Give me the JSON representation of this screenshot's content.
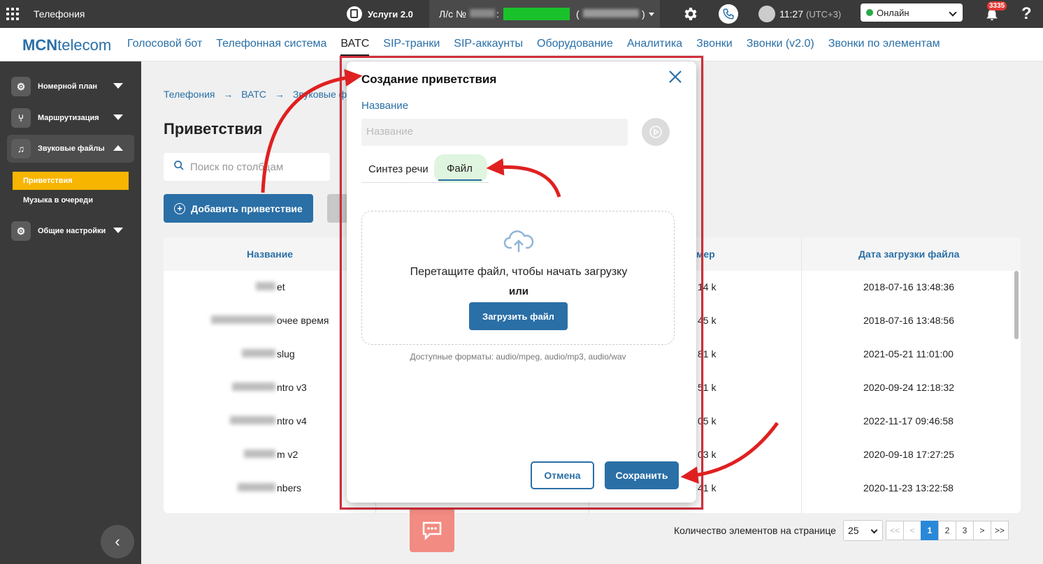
{
  "topbar": {
    "app_title": "Телефония",
    "services": "Услуги 2.0",
    "account_label": "Л/с №",
    "account_colon": ":",
    "account_paren_open": "(",
    "account_paren_close": ")",
    "time": "11:27",
    "timezone": "(UTC+3)",
    "status": "Онлайн",
    "notifications_count": "3335",
    "help": "?"
  },
  "nav": {
    "logo_bold": "MCN",
    "logo_rest": "telecom",
    "items": [
      "Голосовой бот",
      "Телефонная система",
      "ВАТС",
      "SIP-транки",
      "SIP-аккаунты",
      "Оборудование",
      "Аналитика",
      "Звонки",
      "Звонки (v2.0)",
      "Звонки по элементам"
    ],
    "active": "ВАТС"
  },
  "sidebar": {
    "items": [
      {
        "label": "Номерной план",
        "icon": "gear-icon"
      },
      {
        "label": "Маршрутизация",
        "icon": "branch-icon"
      },
      {
        "label": "Звуковые файлы",
        "icon": "music-file-icon"
      },
      {
        "label": "Общие настройки",
        "icon": "gear-icon"
      }
    ],
    "subitems": [
      "Приветствия",
      "Музыка в очереди"
    ]
  },
  "page": {
    "breadcrumb": [
      "Телефония",
      "ВАТС",
      "Звуковые файл"
    ],
    "title": "Приветствия",
    "search_placeholder": "Поиск по столбцам",
    "add_button": "Добавить приветствие"
  },
  "table": {
    "headers": {
      "name": "Название",
      "size": "мер",
      "date": "Дата загрузки файла"
    },
    "rows": [
      {
        "name": "et",
        "size": "14 k",
        "date": "2018-07-16 13:48:36"
      },
      {
        "name": "очее время",
        "size": "45 k",
        "date": "2018-07-16 13:48:56"
      },
      {
        "name": "slug",
        "size": "81 k",
        "date": "2021-05-21 11:01:00"
      },
      {
        "name": "ntro v3",
        "size": "51 k",
        "date": "2020-09-24 12:18:32"
      },
      {
        "name": "ntro v4",
        "size": "05 k",
        "date": "2022-11-17 09:46:58"
      },
      {
        "name": "m v2",
        "size": "03 k",
        "date": "2020-09-18 17:27:25"
      },
      {
        "name": "nbers",
        "size": "41 k",
        "date": "2020-11-23 13:22:58"
      }
    ]
  },
  "pagination": {
    "label": "Количество элементов на странице",
    "page_size": "25",
    "first": "<<",
    "prev": "<",
    "pages": [
      "1",
      "2",
      "3"
    ],
    "current": "1",
    "next": ">",
    "last": ">>"
  },
  "modal": {
    "title": "Создание приветствия",
    "name_label": "Название",
    "name_placeholder": "Название",
    "tabs": [
      "Синтез речи",
      "Файл"
    ],
    "active_tab": "Файл",
    "drop_text": "Перетащите файл, чтобы начать загрузку",
    "or_text": "или",
    "upload_button": "Загрузить файл",
    "formats": "Доступные форматы: audio/mpeg, audio/mp3, audio/wav",
    "cancel": "Отмена",
    "save": "Сохранить"
  },
  "colors": {
    "accent": "#2a6fa6",
    "sidebar_bg": "#3a3a3a",
    "highlight": "#f7b500",
    "annotation": "#e02020",
    "online": "#2ba84a"
  }
}
